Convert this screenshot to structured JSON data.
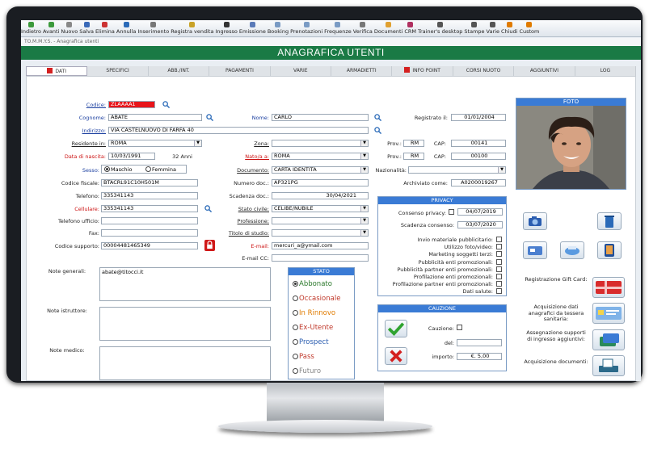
{
  "toolbar": {
    "items": [
      {
        "label": "Indietro",
        "icon": "back-icon"
      },
      {
        "label": "Avanti",
        "icon": "forward-icon"
      },
      {
        "label": "Nuovo",
        "icon": "new-icon"
      },
      {
        "label": "Salva",
        "icon": "save-icon"
      },
      {
        "label": "Elimina",
        "icon": "delete-icon"
      },
      {
        "label": "Annulla",
        "icon": "undo-icon"
      },
      {
        "label": "Inserimento",
        "icon": "insert-icon"
      },
      {
        "label": "Registra vendita",
        "icon": "sale-icon"
      },
      {
        "label": "Ingresso",
        "icon": "entry-icon"
      },
      {
        "label": "Emissione",
        "icon": "issue-icon"
      },
      {
        "label": "Booking",
        "icon": "booking-icon"
      },
      {
        "label": "Prenotazioni",
        "icon": "reservations-icon"
      },
      {
        "label": "Frequenze",
        "icon": "frequency-icon"
      },
      {
        "label": "Verifica",
        "icon": "check-icon"
      },
      {
        "label": "Documenti",
        "icon": "documents-icon"
      },
      {
        "label": "CRM",
        "icon": "crm-icon"
      },
      {
        "label": "Trainer's desktop",
        "icon": "trainer-icon"
      },
      {
        "label": "Stampe",
        "icon": "print-icon"
      },
      {
        "label": "Varie",
        "icon": "misc-icon"
      },
      {
        "label": "Chiudi",
        "icon": "close-icon"
      },
      {
        "label": "Custom",
        "icon": "custom-icon"
      }
    ]
  },
  "window_title": "TO.M.M.Y.S. - Anagrafica utenti",
  "banner": "ANAGRAFICA UTENTI",
  "tabs": [
    "DATI",
    "SPECIFICI",
    "ABB./INT.",
    "PAGAMENTI",
    "VARIE",
    "ARMADIETTI",
    "INFO POINT",
    "CORSI NUOTO",
    "AGGIUNTIVI",
    "LOG"
  ],
  "form": {
    "codice_label": "Codice:",
    "codice": "ZLAAAA1",
    "cognome_label": "Cognome:",
    "cognome": "ABATE",
    "nome_label": "Nome:",
    "nome": "CARLO",
    "registrato_label": "Registrato il:",
    "registrato": "01/01/2004",
    "indirizzo_label": "Indirizzo:",
    "indirizzo": "VIA CASTELNUOVO DI FARFA 40",
    "residente_label": "Residente in:",
    "residente": "ROMA",
    "zona_label": "Zona:",
    "zona": "",
    "prov_label": "Prov.:",
    "prov_res": "RM",
    "cap_label": "CAP:",
    "cap_res": "00141",
    "nascita_label": "Data di nascita:",
    "nascita": "10/03/1991",
    "eta": "32 Anni",
    "nato_label": "Nato/a a:",
    "nato": "ROMA",
    "prov_nasc": "RM",
    "cap_nasc": "00100",
    "sesso_label": "Sesso:",
    "maschio": "Maschio",
    "femmina": "Femmina",
    "documento_label": "Documento:",
    "documento": "CARTA IDENTITÀ",
    "nazionalita_label": "Nazionalità:",
    "nazionalita": "",
    "cf_label": "Codice fiscale:",
    "cf": "BTACRL91C10H501M",
    "numdoc_label": "Numero doc.:",
    "numdoc": "AP321PG",
    "archiviato_label": "Archiviato come:",
    "archiviato": "A0200019267",
    "telefono_label": "Telefono:",
    "telefono": "335341143",
    "scadenza_label": "Scadenza doc.:",
    "scadenza": "30/04/2021",
    "cellulare_label": "Cellulare:",
    "cellulare": "335341143",
    "civile_label": "Stato civile:",
    "civile": "CELIBE/NUBILE",
    "tel_uff_label": "Telefono ufficio:",
    "tel_uff": "",
    "professione_label": "Professione:",
    "professione": "",
    "fax_label": "Fax:",
    "fax": "",
    "studio_label": "Titolo di studio:",
    "studio": "",
    "supporto_label": "Codice supporto:",
    "supporto": "00004481465349",
    "email_label": "E-mail:",
    "email": "mercuri_a@ymail.com",
    "emailcc_label": "E-mail CC:",
    "emailcc": "",
    "note_gen_label": "Note generali:",
    "note_gen": "abate@titocci.it",
    "note_istr_label": "Note istruttore:",
    "note_med_label": "Note medico:"
  },
  "privacy": {
    "title": "PRIVACY",
    "consenso_label": "Consenso privacy:",
    "consenso_date": "04/07/2019",
    "scadenza_label": "Scadenza consenso:",
    "scadenza": "03/07/2020",
    "items": [
      "Invio materiale pubblicitario:",
      "Utilizzo foto/video:",
      "Marketing soggetti terzi:",
      "Pubblicità enti promozionali:",
      "Pubblicità partner enti promozionali:",
      "Profilazione enti promozionali:",
      "Profilazione partner enti promozionali:",
      "Dati salute:"
    ]
  },
  "stato": {
    "title": "STATO",
    "options": [
      {
        "label": "Abbonato",
        "color": "#2d7a2d"
      },
      {
        "label": "Occasionale",
        "color": "#c0392b"
      },
      {
        "label": "In Rinnovo",
        "color": "#e07b00"
      },
      {
        "label": "Ex-Utente",
        "color": "#c0392b"
      },
      {
        "label": "Prospect",
        "color": "#2a5db0"
      },
      {
        "label": "Pass",
        "color": "#c0392b"
      },
      {
        "label": "Futuro",
        "color": "#888888"
      }
    ],
    "selected": "Abbonato"
  },
  "cauzione": {
    "title": "CAUZIONE",
    "cauzione_label": "Cauzione:",
    "del_label": "del:",
    "del": "",
    "importo_label": "importo:",
    "importo": "€. 5,00"
  },
  "foto": {
    "title": "FOTO"
  },
  "side": {
    "gift": "Registrazione Gift Card:",
    "tessera": "Acquisizione dati anagrafici da tessera sanitaria:",
    "supporti": "Assegnazione supporti di ingresso aggiuntivi:",
    "documenti": "Acquisizione documenti:"
  }
}
